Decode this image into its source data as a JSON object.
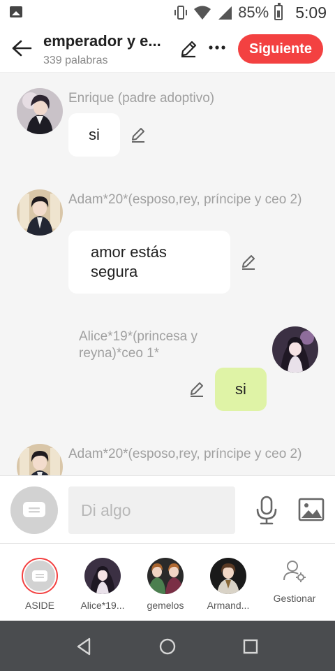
{
  "status": {
    "battery": "85%",
    "time": "5:09"
  },
  "header": {
    "title": "emperador y e...",
    "word_count": "339 palabras",
    "next_label": "Siguiente"
  },
  "messages": [
    {
      "name": "Enrique (padre adoptivo)",
      "text": "si"
    },
    {
      "name": "Adam*20*(esposo,rey, príncipe y ceo 2)",
      "text": "amor estás segura"
    },
    {
      "name": "Alice*19*(princesa y reyna)*ceo 1*",
      "text": "si"
    },
    {
      "name": "Adam*20*(esposo,rey, príncipe y ceo 2)",
      "text": ""
    }
  ],
  "input": {
    "placeholder": "Di algo"
  },
  "characters": [
    {
      "label": "ASIDE"
    },
    {
      "label": "Alice*19..."
    },
    {
      "label": "gemelos"
    },
    {
      "label": "Armand..."
    },
    {
      "label": "Gestionar"
    }
  ],
  "colors": {
    "accent": "#f34141",
    "my_bubble": "#dff3a6",
    "nav_bg": "#4a4c4f"
  }
}
